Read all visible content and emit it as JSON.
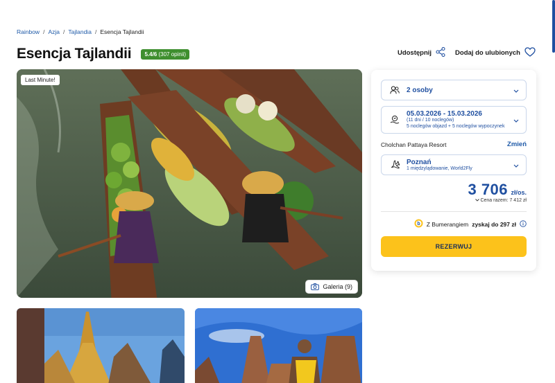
{
  "breadcrumb": {
    "items": [
      "Rainbow",
      "Azja",
      "Tajlandia"
    ],
    "separator": "/",
    "current": "Esencja Tajlandii"
  },
  "header": {
    "title": "Esencja Tajlandii",
    "rating": "5.4/6",
    "opinions": "(307 opinii)",
    "share_label": "Udostępnij",
    "favorite_label": "Dodaj do ulubionych"
  },
  "hero": {
    "badge": "Last Minute!",
    "gallery_label": "Galeria (9)",
    "icon": "camera-icon"
  },
  "booking": {
    "persons": "2 osoby",
    "dates_main": "05.03.2026 - 15.03.2026",
    "dates_sub1": "(11 dni / 10 noclegów)",
    "dates_sub2": "5 noclegów objazd + 5 noclegów wypoczynek",
    "hotel": "Cholchan Pattaya Resort",
    "change_label": "Zmień",
    "departure": "Poznań",
    "departure_sub": "1 międzylądowanie, World2Fly",
    "price": "3 706",
    "currency": "zł/os.",
    "total_label": "Cena razem: 7 412 zł",
    "bumerang_prefix": "Z Bumerangiem",
    "bumerang_bold": "zyskaj do 297 zł",
    "reserve_label": "REZERWUJ"
  },
  "colors": {
    "accent_blue": "#1f4fa0",
    "rating_green": "#3f8f2f",
    "button_yellow": "#fcc21b"
  }
}
